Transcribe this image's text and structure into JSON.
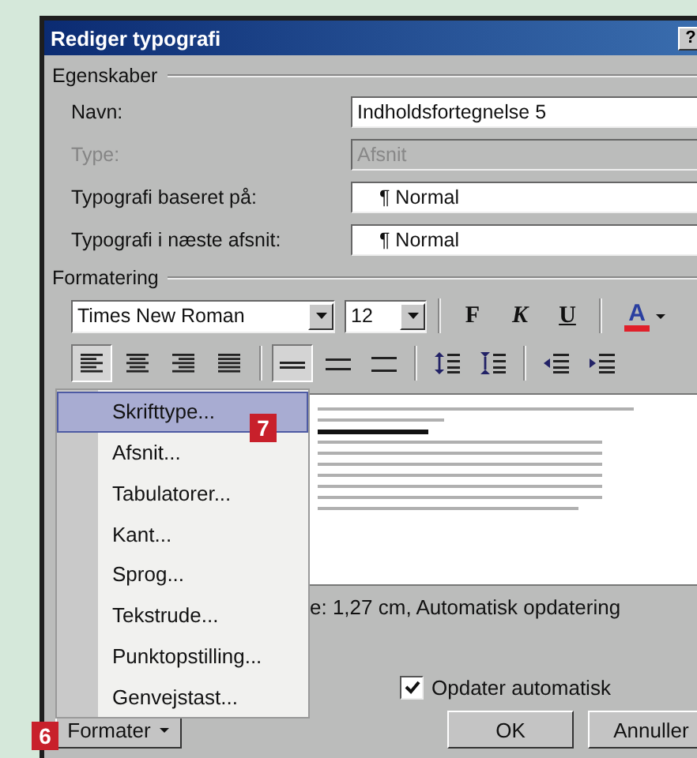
{
  "window": {
    "title": "Rediger typografi",
    "help_button": "?"
  },
  "properties": {
    "legend": "Egenskaber",
    "rows": [
      {
        "label": "Navn:",
        "value": "Indholdsfortegnelse 5",
        "kind": "text",
        "disabled": false
      },
      {
        "label": "Type:",
        "value": "Afsnit",
        "kind": "select",
        "disabled": true
      },
      {
        "label": "Typografi baseret på:",
        "value": "¶ Normal",
        "kind": "select",
        "disabled": false
      },
      {
        "label": "Typografi i næste afsnit:",
        "value": "¶ Normal",
        "kind": "select",
        "disabled": false
      }
    ]
  },
  "formatting": {
    "legend": "Formatering",
    "font": "Times New Roman",
    "size": "12",
    "style_buttons": [
      {
        "label": "F",
        "kind": "bold"
      },
      {
        "label": "K",
        "kind": "italic"
      },
      {
        "label": "U",
        "kind": "underline"
      }
    ],
    "font_color": {
      "label": "A",
      "color": "#e0202a"
    },
    "alignment": [
      {
        "kind": "left",
        "selected": true
      },
      {
        "kind": "center",
        "selected": false
      },
      {
        "kind": "right",
        "selected": false
      },
      {
        "kind": "justify",
        "selected": false
      }
    ],
    "line_spacing": [
      {
        "kind": "single",
        "selected": true
      },
      {
        "kind": "one-half",
        "selected": false
      },
      {
        "kind": "double",
        "selected": false
      }
    ]
  },
  "description": "e:  1,27 cm, Automatisk opdatering",
  "auto_update": {
    "label": "Opdater automatisk",
    "checked": true
  },
  "buttons": {
    "format": "Formater",
    "ok": "OK",
    "cancel": "Annuller"
  },
  "format_menu": [
    {
      "label": "Skrifttype...",
      "selected": true
    },
    {
      "label": "Afsnit...",
      "selected": false
    },
    {
      "label": "Tabulatorer...",
      "selected": false
    },
    {
      "label": "Kant...",
      "selected": false
    },
    {
      "label": "Sprog...",
      "selected": false
    },
    {
      "label": "Tekstrude...",
      "selected": false
    },
    {
      "label": "Punktopstilling...",
      "selected": false
    },
    {
      "label": "Genvejstast...",
      "selected": false
    }
  ],
  "callouts": [
    "6",
    "7"
  ]
}
